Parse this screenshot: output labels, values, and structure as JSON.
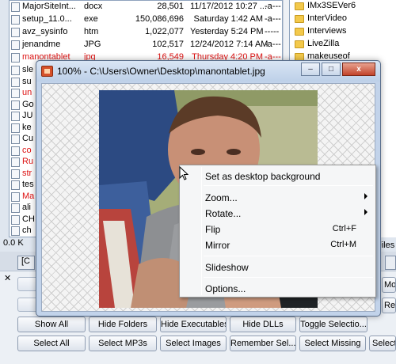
{
  "files": [
    {
      "name": "MajorSiteInt...",
      "ext": "docx",
      "size": "28,501",
      "date": "11/17/2012 10:27 ...",
      "attr": "-a---",
      "red": false
    },
    {
      "name": "setup_11.0...",
      "ext": "exe",
      "size": "150,086,696",
      "date": "Saturday 1:42 AM",
      "attr": "-a---",
      "red": false
    },
    {
      "name": "avz_sysinfo",
      "ext": "htm",
      "size": "1,022,077",
      "date": "Yesterday 5:24 PM",
      "attr": "-----",
      "red": false
    },
    {
      "name": "jenandme",
      "ext": "JPG",
      "size": "102,517",
      "date": "12/24/2012 7:14 AM",
      "attr": "-a---",
      "red": false
    },
    {
      "name": "manontablet",
      "ext": "jpg",
      "size": "16,549",
      "date": "Thursday 4:20 PM",
      "attr": "-a---",
      "red": true
    }
  ],
  "left_partial_rows": [
    {
      "text": "sle",
      "red": false
    },
    {
      "text": "su",
      "red": false
    },
    {
      "text": "un",
      "red": true
    },
    {
      "text": "Go",
      "red": false
    },
    {
      "text": "JU",
      "red": false
    },
    {
      "text": "ke",
      "red": false
    },
    {
      "text": "Cu",
      "red": false
    },
    {
      "text": "co",
      "red": true
    },
    {
      "text": "Ru",
      "red": true
    },
    {
      "text": "str",
      "red": true
    },
    {
      "text": "tes",
      "red": false
    },
    {
      "text": "Ma",
      "red": true
    },
    {
      "text": "ali",
      "red": false
    },
    {
      "text": "CH",
      "red": false
    },
    {
      "text": "ch",
      "red": false
    }
  ],
  "folders": [
    "IMx3SEVer6",
    "InterVideo",
    "Interviews",
    "LiveZilla",
    "makeuseof"
  ],
  "status": {
    "size_text": "0.0 K",
    "files_label": "Files"
  },
  "tabs": {
    "left_tab": "[C",
    "close_glyph": "✕"
  },
  "viewer": {
    "title": "100% - C:\\Users\\Owner\\Desktop\\manontablet.jpg",
    "minimize": "‒",
    "maximize": "□",
    "close": "x"
  },
  "context_menu": {
    "items": [
      {
        "label": "Set as desktop background",
        "shortcut": "",
        "submenu": false
      },
      {
        "label": "Zoom...",
        "shortcut": "",
        "submenu": true
      },
      {
        "label": "Rotate...",
        "shortcut": "",
        "submenu": true
      },
      {
        "label": "Flip",
        "shortcut": "Ctrl+F",
        "submenu": false
      },
      {
        "label": "Mirror",
        "shortcut": "Ctrl+M",
        "submenu": false
      },
      {
        "label": "Slideshow",
        "shortcut": "",
        "submenu": false
      },
      {
        "label": "Options...",
        "shortcut": "",
        "submenu": false
      }
    ]
  },
  "buttons_row1": [
    "Show All",
    "Hide Folders",
    "Hide Executables",
    "Hide DLLs",
    "Toggle Selectio..."
  ],
  "buttons_row2": [
    "Select All",
    "Select MP3s",
    "Select Images",
    "Remember Sel...",
    "Select Missing",
    "Select"
  ],
  "right_partial_labels": [
    "Mo",
    "Regis"
  ],
  "colors": {
    "highlight_red": "#dd1111",
    "folder_yellow": "#f3c94b",
    "titlebar_blue": "#c2d3ea"
  }
}
